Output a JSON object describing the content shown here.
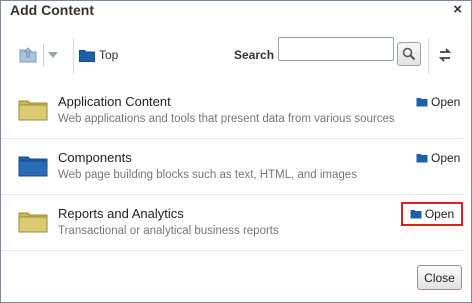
{
  "dialog": {
    "title": "Add Content",
    "close_glyph": "×"
  },
  "toolbar": {
    "top_label": "Top",
    "search_label": "Search",
    "search_value": "",
    "search_placeholder": ""
  },
  "items": [
    {
      "name": "Application Content",
      "description": "Web applications and tools that present data from various sources",
      "open_label": "Open",
      "folder_color": "#c8b45a"
    },
    {
      "name": "Components",
      "description": "Web page building blocks such as text, HTML, and images",
      "open_label": "Open",
      "folder_color": "#1f5fa8"
    },
    {
      "name": "Reports and Analytics",
      "description": "Transactional or analytical business reports",
      "open_label": "Open",
      "folder_color": "#c8b45a"
    }
  ],
  "footer": {
    "close_label": "Close"
  },
  "colors": {
    "highlight": "#dd2222",
    "link_folder": "#1f5fa8"
  }
}
